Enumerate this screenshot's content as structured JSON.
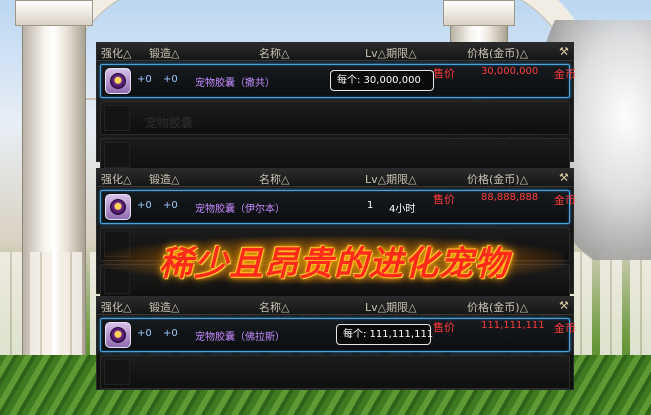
{
  "headers": {
    "strengthen": "强化△",
    "forge": "锻造△",
    "name": "名称△",
    "lv_duration": "Lv△期限△",
    "price": "价格(金币)△",
    "hammer": "⚒"
  },
  "panels": [
    {
      "item": {
        "strengthen": "+0",
        "forge": "+0",
        "name": "宠物胶囊（撒共）",
        "lv": "",
        "duration": "",
        "sell_label": "售价",
        "price": "30,000,000",
        "unit": "金币"
      },
      "tooltip": "每个: 30,000,000",
      "extra_rows": [
        {
          "text": "宠物胶囊"
        },
        {
          "text": ""
        }
      ]
    },
    {
      "item": {
        "strengthen": "+0",
        "forge": "+0",
        "name": "宠物胶囊（伊尔本）",
        "lv": "1",
        "duration": "4小时",
        "sell_label": "售价",
        "price": "88,888,888",
        "unit": "金币"
      },
      "tooltip": "",
      "extra_rows": [
        {
          "text": ""
        },
        {
          "text": ""
        }
      ]
    },
    {
      "item": {
        "strengthen": "+0",
        "forge": "+0",
        "name": "宠物胶囊（佛拉斯）",
        "lv": "",
        "duration": "",
        "sell_label": "售价",
        "price": "111,111,111",
        "unit": "金币"
      },
      "tooltip": "每个: 111,111,111",
      "extra_rows": [
        {
          "text": ""
        }
      ]
    }
  ],
  "banner": "稀少且昂贵的进化宠物",
  "colors": {
    "price_red": "#ff3c3c",
    "name_purple": "#c38cff",
    "highlight_blue": "#4aa3d8",
    "banner_red": "#ff2a1a",
    "banner_glow": "#ffb000"
  }
}
